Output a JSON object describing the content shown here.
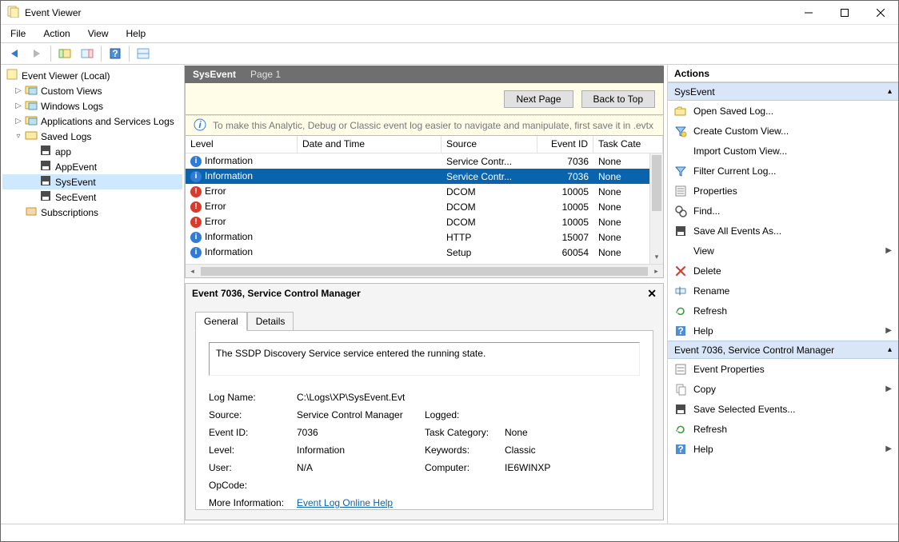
{
  "window": {
    "title": "Event Viewer"
  },
  "menu": {
    "file": "File",
    "action": "Action",
    "view": "View",
    "help": "Help"
  },
  "tree": {
    "root": "Event Viewer (Local)",
    "custom_views": "Custom Views",
    "windows_logs": "Windows Logs",
    "apps_logs": "Applications and Services Logs",
    "saved_logs": "Saved Logs",
    "saved_children": {
      "app": "app",
      "appevent": "AppEvent",
      "sysevent": "SysEvent",
      "secevent": "SecEvent"
    },
    "subscriptions": "Subscriptions"
  },
  "center": {
    "header_name": "SysEvent",
    "header_page": "Page 1",
    "btn_next": "Next Page",
    "btn_top": "Back to Top",
    "tip": "To make this Analytic, Debug or Classic event log easier to navigate and manipulate, first save it in .evtx",
    "columns": {
      "level": "Level",
      "datetime": "Date and Time",
      "source": "Source",
      "eventid": "Event ID",
      "taskcat": "Task Cate"
    },
    "rows": [
      {
        "level": "Information",
        "lvl": "info",
        "dt": "",
        "src": "Service Contr...",
        "id": "7036",
        "tc": "None"
      },
      {
        "level": "Information",
        "lvl": "info",
        "dt": "",
        "src": "Service Contr...",
        "id": "7036",
        "tc": "None"
      },
      {
        "level": "Error",
        "lvl": "err",
        "dt": "",
        "src": "DCOM",
        "id": "10005",
        "tc": "None"
      },
      {
        "level": "Error",
        "lvl": "err",
        "dt": "",
        "src": "DCOM",
        "id": "10005",
        "tc": "None"
      },
      {
        "level": "Error",
        "lvl": "err",
        "dt": "",
        "src": "DCOM",
        "id": "10005",
        "tc": "None"
      },
      {
        "level": "Information",
        "lvl": "info",
        "dt": "",
        "src": "HTTP",
        "id": "15007",
        "tc": "None"
      },
      {
        "level": "Information",
        "lvl": "info",
        "dt": "",
        "src": "Setup",
        "id": "60054",
        "tc": "None"
      }
    ],
    "detail_title": "Event 7036, Service Control Manager",
    "tabs": {
      "general": "General",
      "details": "Details"
    },
    "description": "The SSDP Discovery Service service entered the running state.",
    "props": {
      "logname_l": "Log Name:",
      "logname_v": "C:\\Logs\\XP\\SysEvent.Evt",
      "source_l": "Source:",
      "source_v": "Service Control Manager",
      "logged_l": "Logged:",
      "logged_v": "",
      "eventid_l": "Event ID:",
      "eventid_v": "7036",
      "taskcat_l": "Task Category:",
      "taskcat_v": "None",
      "level_l": "Level:",
      "level_v": "Information",
      "keywords_l": "Keywords:",
      "keywords_v": "Classic",
      "user_l": "User:",
      "user_v": "N/A",
      "computer_l": "Computer:",
      "computer_v": "IE6WINXP",
      "opcode_l": "OpCode:",
      "opcode_v": "",
      "moreinfo_l": "More Information:",
      "moreinfo_link": "Event Log Online Help"
    }
  },
  "actions": {
    "title": "Actions",
    "section1": "SysEvent",
    "items1": {
      "open": "Open Saved Log...",
      "createcv": "Create Custom View...",
      "importcv": "Import Custom View...",
      "filter": "Filter Current Log...",
      "properties": "Properties",
      "find": "Find...",
      "saveall": "Save All Events As...",
      "view": "View",
      "delete": "Delete",
      "rename": "Rename",
      "refresh": "Refresh",
      "help": "Help"
    },
    "section2": "Event 7036, Service Control Manager",
    "items2": {
      "evtprops": "Event Properties",
      "copy": "Copy",
      "savesel": "Save Selected Events...",
      "refresh": "Refresh",
      "help": "Help"
    }
  }
}
